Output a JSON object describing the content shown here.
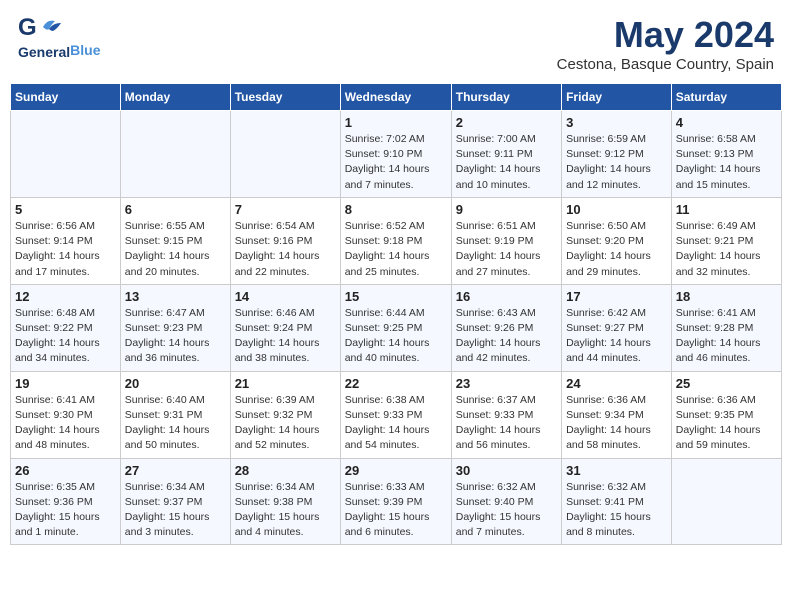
{
  "header": {
    "logo_general": "General",
    "logo_blue": "Blue",
    "month_title": "May 2024",
    "location": "Cestona, Basque Country, Spain"
  },
  "weekdays": [
    "Sunday",
    "Monday",
    "Tuesday",
    "Wednesday",
    "Thursday",
    "Friday",
    "Saturday"
  ],
  "weeks": [
    [
      {
        "day": "",
        "info": ""
      },
      {
        "day": "",
        "info": ""
      },
      {
        "day": "",
        "info": ""
      },
      {
        "day": "1",
        "info": "Sunrise: 7:02 AM\nSunset: 9:10 PM\nDaylight: 14 hours\nand 7 minutes."
      },
      {
        "day": "2",
        "info": "Sunrise: 7:00 AM\nSunset: 9:11 PM\nDaylight: 14 hours\nand 10 minutes."
      },
      {
        "day": "3",
        "info": "Sunrise: 6:59 AM\nSunset: 9:12 PM\nDaylight: 14 hours\nand 12 minutes."
      },
      {
        "day": "4",
        "info": "Sunrise: 6:58 AM\nSunset: 9:13 PM\nDaylight: 14 hours\nand 15 minutes."
      }
    ],
    [
      {
        "day": "5",
        "info": "Sunrise: 6:56 AM\nSunset: 9:14 PM\nDaylight: 14 hours\nand 17 minutes."
      },
      {
        "day": "6",
        "info": "Sunrise: 6:55 AM\nSunset: 9:15 PM\nDaylight: 14 hours\nand 20 minutes."
      },
      {
        "day": "7",
        "info": "Sunrise: 6:54 AM\nSunset: 9:16 PM\nDaylight: 14 hours\nand 22 minutes."
      },
      {
        "day": "8",
        "info": "Sunrise: 6:52 AM\nSunset: 9:18 PM\nDaylight: 14 hours\nand 25 minutes."
      },
      {
        "day": "9",
        "info": "Sunrise: 6:51 AM\nSunset: 9:19 PM\nDaylight: 14 hours\nand 27 minutes."
      },
      {
        "day": "10",
        "info": "Sunrise: 6:50 AM\nSunset: 9:20 PM\nDaylight: 14 hours\nand 29 minutes."
      },
      {
        "day": "11",
        "info": "Sunrise: 6:49 AM\nSunset: 9:21 PM\nDaylight: 14 hours\nand 32 minutes."
      }
    ],
    [
      {
        "day": "12",
        "info": "Sunrise: 6:48 AM\nSunset: 9:22 PM\nDaylight: 14 hours\nand 34 minutes."
      },
      {
        "day": "13",
        "info": "Sunrise: 6:47 AM\nSunset: 9:23 PM\nDaylight: 14 hours\nand 36 minutes."
      },
      {
        "day": "14",
        "info": "Sunrise: 6:46 AM\nSunset: 9:24 PM\nDaylight: 14 hours\nand 38 minutes."
      },
      {
        "day": "15",
        "info": "Sunrise: 6:44 AM\nSunset: 9:25 PM\nDaylight: 14 hours\nand 40 minutes."
      },
      {
        "day": "16",
        "info": "Sunrise: 6:43 AM\nSunset: 9:26 PM\nDaylight: 14 hours\nand 42 minutes."
      },
      {
        "day": "17",
        "info": "Sunrise: 6:42 AM\nSunset: 9:27 PM\nDaylight: 14 hours\nand 44 minutes."
      },
      {
        "day": "18",
        "info": "Sunrise: 6:41 AM\nSunset: 9:28 PM\nDaylight: 14 hours\nand 46 minutes."
      }
    ],
    [
      {
        "day": "19",
        "info": "Sunrise: 6:41 AM\nSunset: 9:30 PM\nDaylight: 14 hours\nand 48 minutes."
      },
      {
        "day": "20",
        "info": "Sunrise: 6:40 AM\nSunset: 9:31 PM\nDaylight: 14 hours\nand 50 minutes."
      },
      {
        "day": "21",
        "info": "Sunrise: 6:39 AM\nSunset: 9:32 PM\nDaylight: 14 hours\nand 52 minutes."
      },
      {
        "day": "22",
        "info": "Sunrise: 6:38 AM\nSunset: 9:33 PM\nDaylight: 14 hours\nand 54 minutes."
      },
      {
        "day": "23",
        "info": "Sunrise: 6:37 AM\nSunset: 9:33 PM\nDaylight: 14 hours\nand 56 minutes."
      },
      {
        "day": "24",
        "info": "Sunrise: 6:36 AM\nSunset: 9:34 PM\nDaylight: 14 hours\nand 58 minutes."
      },
      {
        "day": "25",
        "info": "Sunrise: 6:36 AM\nSunset: 9:35 PM\nDaylight: 14 hours\nand 59 minutes."
      }
    ],
    [
      {
        "day": "26",
        "info": "Sunrise: 6:35 AM\nSunset: 9:36 PM\nDaylight: 15 hours\nand 1 minute."
      },
      {
        "day": "27",
        "info": "Sunrise: 6:34 AM\nSunset: 9:37 PM\nDaylight: 15 hours\nand 3 minutes."
      },
      {
        "day": "28",
        "info": "Sunrise: 6:34 AM\nSunset: 9:38 PM\nDaylight: 15 hours\nand 4 minutes."
      },
      {
        "day": "29",
        "info": "Sunrise: 6:33 AM\nSunset: 9:39 PM\nDaylight: 15 hours\nand 6 minutes."
      },
      {
        "day": "30",
        "info": "Sunrise: 6:32 AM\nSunset: 9:40 PM\nDaylight: 15 hours\nand 7 minutes."
      },
      {
        "day": "31",
        "info": "Sunrise: 6:32 AM\nSunset: 9:41 PM\nDaylight: 15 hours\nand 8 minutes."
      },
      {
        "day": "",
        "info": ""
      }
    ]
  ]
}
